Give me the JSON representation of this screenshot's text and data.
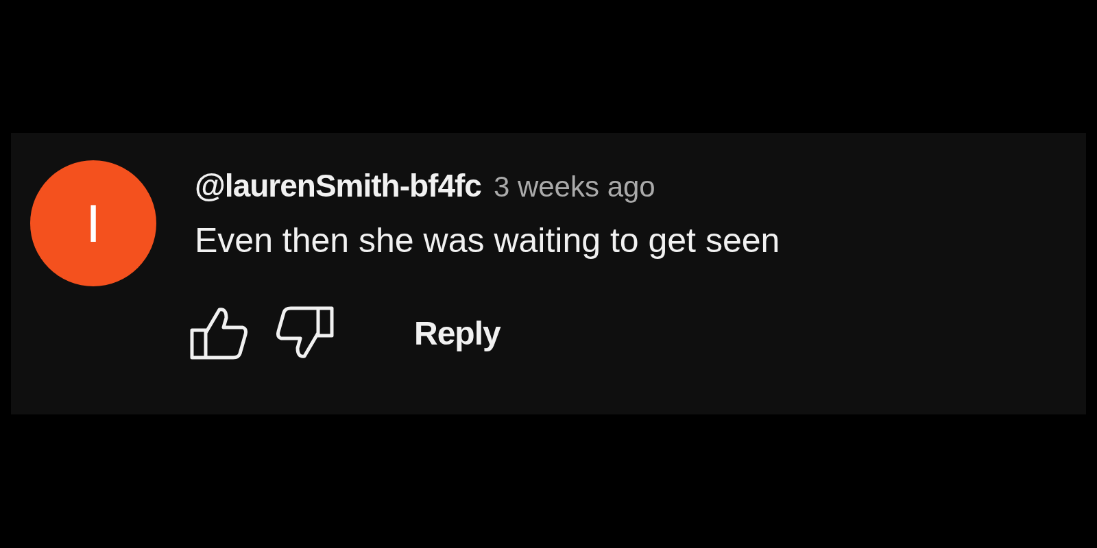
{
  "comment": {
    "avatar_letter": "I",
    "author": "@laurenSmith-bf4fc",
    "time": "3 weeks ago",
    "text": "Even then she was waiting to get seen",
    "reply": "Reply"
  }
}
